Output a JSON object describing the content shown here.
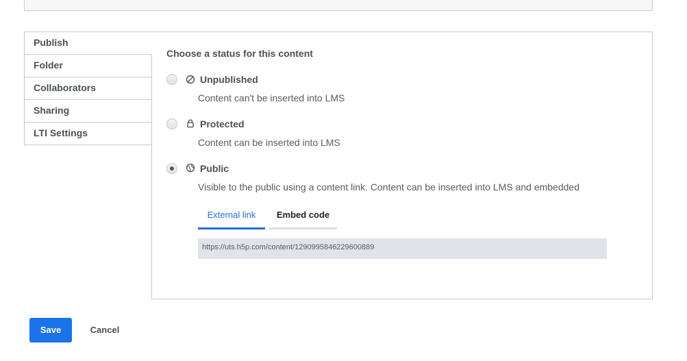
{
  "nav": {
    "items": [
      {
        "label": "Publish"
      },
      {
        "label": "Folder"
      },
      {
        "label": "Collaborators"
      },
      {
        "label": "Sharing"
      },
      {
        "label": "LTI Settings"
      }
    ]
  },
  "publish": {
    "heading": "Choose a status for this content",
    "options": [
      {
        "title": "Unpublished",
        "description": "Content can't be inserted into LMS",
        "icon": "unpublished-icon",
        "checked": false
      },
      {
        "title": "Protected",
        "description": "Content can be inserted into LMS",
        "icon": "lock-icon",
        "checked": false
      },
      {
        "title": "Public",
        "description": "Visible to the public using a content link. Content can be inserted into LMS and embedded",
        "icon": "globe-icon",
        "checked": true
      }
    ],
    "tabs": [
      {
        "label": "External link",
        "active": true
      },
      {
        "label": "Embed code",
        "active": false
      }
    ],
    "link": "https://uts.h5p.com/content/1290995846229600889"
  },
  "actions": {
    "save_label": "Save",
    "cancel_label": "Cancel"
  },
  "colors": {
    "accent": "#1a73e8",
    "link_box_bg": "#e1e3ea"
  }
}
